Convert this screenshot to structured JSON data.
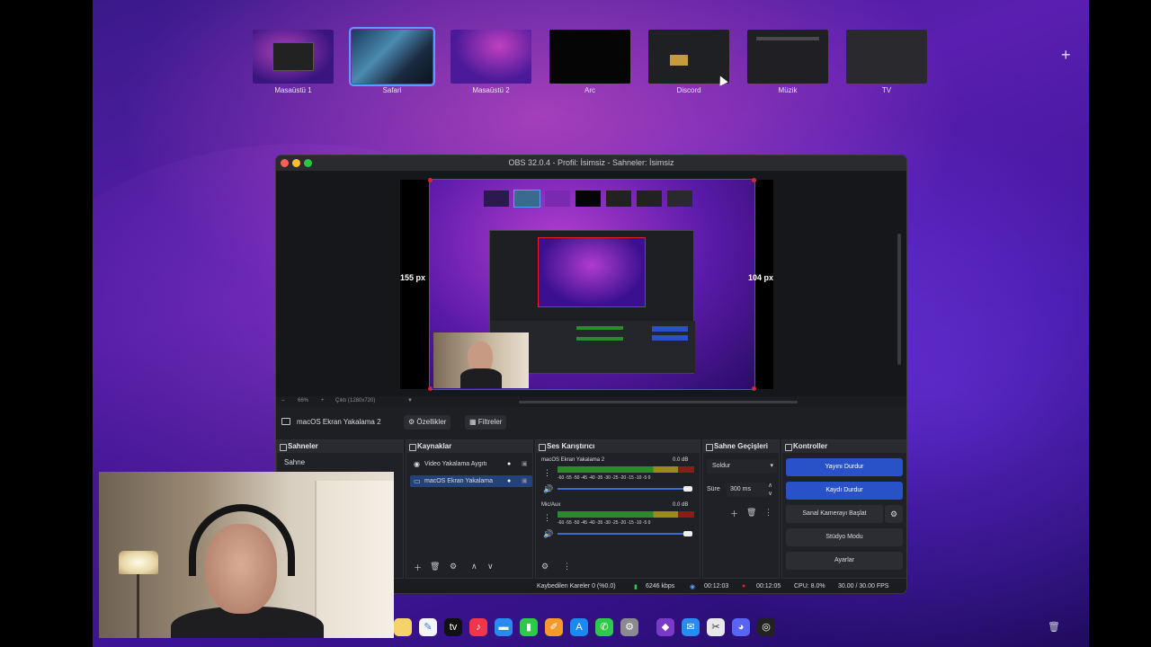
{
  "mission_control": {
    "spaces": [
      {
        "label": "Masaüstü 1"
      },
      {
        "label": "Safari"
      },
      {
        "label": "Masaüstü 2"
      },
      {
        "label": "Arc"
      },
      {
        "label": "Discord"
      },
      {
        "label": "Müzik"
      },
      {
        "label": "TV"
      }
    ],
    "add_space": "+"
  },
  "obs": {
    "title": "OBS 32.0.4 - Profil: İsimsiz - Sahneler: İsimsiz",
    "preview": {
      "left_offset": "155 px",
      "right_offset": "104 px",
      "zoom": "66%",
      "output": "Çıktı (1280x720)"
    },
    "context_bar": {
      "source_name": "macOS Ekran Yakalama 2",
      "properties": "Özellikler",
      "filters": "Filtreler"
    },
    "scenes": {
      "title": "Sahneler",
      "items": [
        "Sahne"
      ]
    },
    "sources": {
      "title": "Kaynaklar",
      "items": [
        "Video Yakalama Aygıtı",
        "macOS Ekran Yakalama"
      ]
    },
    "mixer": {
      "title": "Ses Karıştırıcı",
      "channels": [
        {
          "name": "macOS Ekran Yakalama 2",
          "db": "0.0 dB"
        },
        {
          "name": "Mic/Aux",
          "db": "0.0 dB"
        }
      ],
      "scale": "-60 -55 -50 -45 -40 -35 -30 -25 -20 -15 -10 -5 0"
    },
    "transitions": {
      "title": "Sahne Geçişleri",
      "type": "Soldur",
      "duration_label": "Süre",
      "duration": "300 ms"
    },
    "controls": {
      "title": "Kontroller",
      "stop_stream": "Yayını Durdur",
      "stop_record": "Kaydı Durdur",
      "virtual_cam": "Sanal Kamerayı Başlat",
      "studio_mode": "Stüdyo Modu",
      "settings": "Ayarlar"
    },
    "status": {
      "dropped": "Kaybedilen Kareler 0 (%0.0)",
      "bitrate": "6246 kbps",
      "stream_time": "00:12:03",
      "record_time": "00:12:05",
      "cpu": "CPU: 8.0%",
      "fps": "30.00 / 30.00 FPS"
    }
  },
  "colors": {
    "accent_blue": "#2a52c8",
    "record_red": "#e0202a",
    "window_bg": "#1e1f23"
  }
}
